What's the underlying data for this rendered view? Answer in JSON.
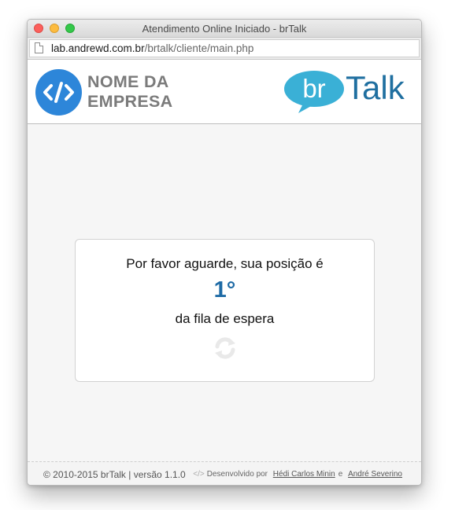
{
  "window": {
    "title": "Atendimento Online Iniciado - brTalk"
  },
  "urlbar": {
    "host": "lab.andrewd.com.br",
    "path": "/brtalk/cliente/main.php"
  },
  "header": {
    "company_line1": "NOME DA",
    "company_line2": "EMPRESA",
    "brand_left": "br",
    "brand_right": "Talk"
  },
  "queue": {
    "message_before": "Por favor aguarde, sua posição é",
    "position": "1°",
    "message_after": "da fila de espera"
  },
  "footer": {
    "copyright": "© 2010-2015 brTalk | versão 1.1.0",
    "developed_by": "Desenvolvido por",
    "author1": "Hédi Carlos Minin",
    "conjunction": "e",
    "author2": "André Severino"
  },
  "colors": {
    "logo_blue": "#2d86d9",
    "brand_bubble": "#3ab0d6",
    "brand_text": "#1f6fa0",
    "position_blue": "#1e6aa5"
  },
  "icons": {
    "company_logo": "code-brackets-icon",
    "loading": "refresh-icon",
    "page": "document-icon"
  }
}
